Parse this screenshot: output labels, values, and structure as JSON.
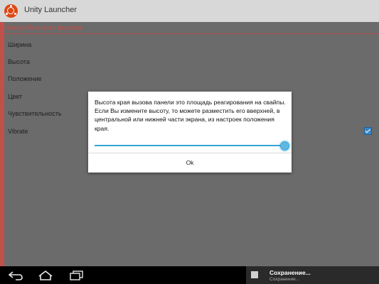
{
  "app": {
    "title": "Unity Launcher",
    "accent_color": "#dd4814",
    "icon": "ubuntu-logo-icon"
  },
  "settings": {
    "section_title": "Настройки края вызова",
    "items": [
      {
        "label": "Ширина"
      },
      {
        "label": "Высота"
      },
      {
        "label": "Положение"
      },
      {
        "label": "Цвет"
      },
      {
        "label": "Чувствительность"
      },
      {
        "label": "Vibrate",
        "checked": true
      }
    ]
  },
  "dialog": {
    "message": "Высота края вызова панели это площадь реагирования на свайпы. Если Вы измените высоту, то можете разместить его вверхней, в центральной или нижней части экрана, из настроек положения края.",
    "slider_value": 1.0,
    "ok_label": "Ok"
  },
  "navbar": {
    "back_icon": "back-icon",
    "home_icon": "home-icon",
    "recents_icon": "recent-apps-icon"
  },
  "notification": {
    "icon": "image-icon",
    "title": "Сохранение...",
    "subtitle": "Сохранение..."
  }
}
